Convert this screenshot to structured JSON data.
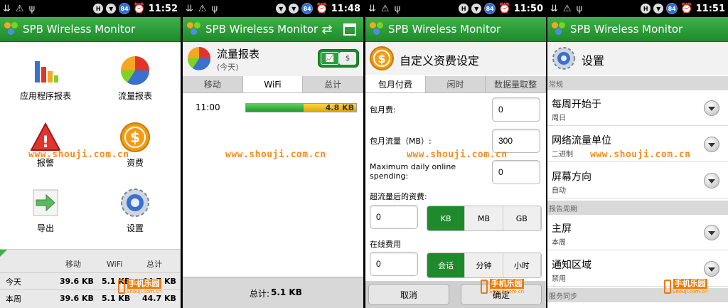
{
  "status_times": [
    "11:52",
    "11:48",
    "11:50",
    "11:51"
  ],
  "battery": "84",
  "app_title": "SPB Wireless Monitor",
  "watermark": "www.shouji.com.cn",
  "brand": {
    "name": "手机乐园",
    "url": "Shouji.com.cn"
  },
  "main_menu": {
    "items": [
      "应用程序报表",
      "流量报表",
      "报警",
      "资费",
      "导出",
      "设置"
    ],
    "stats_headers": [
      "移动",
      "WiFi",
      "总计"
    ],
    "stats_rows": [
      {
        "label": "今天",
        "mobile": "39.6 KB",
        "wifi": "5.1 KB",
        "total": "44.7 KB"
      },
      {
        "label": "本周",
        "mobile": "39.6 KB",
        "wifi": "5.1 KB",
        "total": "44.7 KB"
      }
    ]
  },
  "traffic": {
    "title": "流量报表",
    "subtitle": "(今天)",
    "toggle_chart": "📈",
    "toggle_money": "$",
    "tabs": [
      "移动",
      "WiFi",
      "总计"
    ],
    "active_tab": 1,
    "row_time": "11:00",
    "row_value": "4.8 KB",
    "bar_green_fraction": 0.52,
    "total_label": "总计:",
    "total_value": "5.1 KB"
  },
  "tariff": {
    "title": "自定义资费设定",
    "tabs": [
      "包月付费",
      "闲时",
      "数据量取整"
    ],
    "monthly_fee_label": "包月费:",
    "monthly_fee_value": "0",
    "monthly_traffic_label": "包月流量（MB）:",
    "monthly_traffic_value": "300",
    "max_daily_label": "Maximum daily online spending:",
    "max_daily_value": "0",
    "overage_label": "超流量后的资费:",
    "overage_value": "0",
    "units": [
      "KB",
      "MB",
      "GB"
    ],
    "online_label": "在线费用",
    "online_value": "0",
    "time_units": [
      "会话",
      "分钟",
      "小时"
    ],
    "cancel": "取消",
    "ok": "确定"
  },
  "settings": {
    "title": "设置",
    "sections": [
      "常规",
      "报告周期",
      "服务同步"
    ],
    "items": [
      {
        "title": "每周开始于",
        "value": "周日"
      },
      {
        "title": "网络流量单位",
        "value": "二进制"
      },
      {
        "title": "屏幕方向",
        "value": "自动"
      },
      {
        "title": "主屏",
        "value": "本周"
      },
      {
        "title": "通知区域",
        "value": "禁用"
      }
    ]
  }
}
